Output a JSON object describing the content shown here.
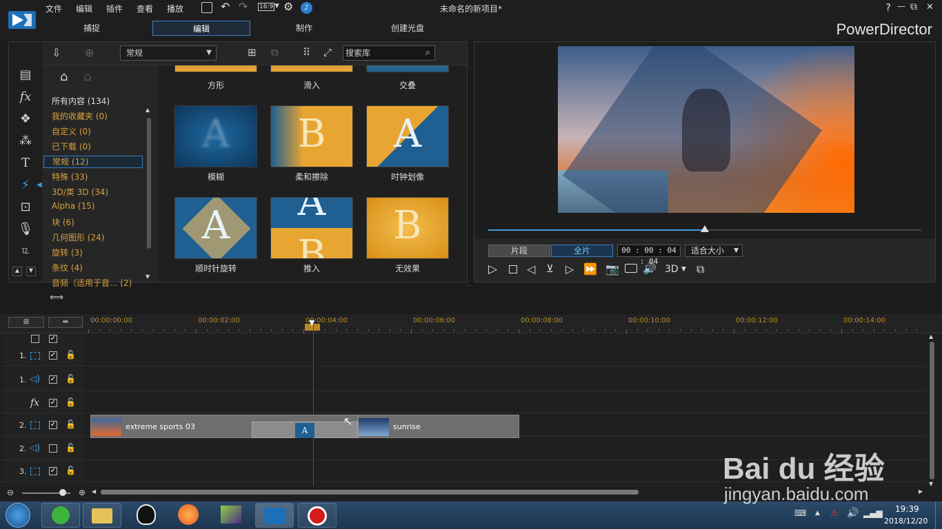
{
  "menu": [
    "文件",
    "编辑",
    "插件",
    "查看",
    "播放"
  ],
  "aspect": "16:9",
  "project_title": "未命名的新项目*",
  "window": {
    "help": "?",
    "min": "—",
    "max": "⧉",
    "close": "✕"
  },
  "tabs": [
    "捕捉",
    "编辑",
    "制作",
    "创建光盘"
  ],
  "brand": "PowerDirector",
  "library": {
    "dropdown": "常规",
    "search_placeholder": "搜索库",
    "categories": [
      "所有内容 (134)",
      "我的收藏夹  (0)",
      "自定义  (0)",
      "已下载  (0)",
      "常规  (12)",
      "特殊  (33)",
      "3D/类 3D  (34)",
      "Alpha  (15)",
      "块  (6)",
      "几何图形  (24)",
      "旋转  (3)",
      "条纹  (4)",
      "音频（适用于音...  (2)"
    ],
    "top_labels": [
      "方形",
      "滑入",
      "交叠"
    ],
    "items": [
      {
        "label": "模糊"
      },
      {
        "label": "柔和擦除"
      },
      {
        "label": "时钟划像"
      },
      {
        "label": "顺时针旋转"
      },
      {
        "label": "推入"
      },
      {
        "label": "无效果"
      }
    ]
  },
  "preview": {
    "clip_btn": "片段",
    "movie_btn": "全片",
    "timecode": "00 : 00 : 04 : 04",
    "fit": "适合大小",
    "mode3d": "3D",
    "progress": 0.5
  },
  "timeline": {
    "ruler": [
      "00:00:00:00",
      "00:00:02:00",
      "00:00:04:00",
      "00:00:06:00",
      "00:00:08:00",
      "00:00:10:00",
      "00:00:12:00",
      "00:00:14:00"
    ],
    "tracks": [
      "1.",
      "1.",
      "fx",
      "2.",
      "2.",
      "3."
    ],
    "clips": [
      {
        "name": "extreme sports 03"
      },
      {
        "name": "sunrise"
      }
    ]
  },
  "taskbar": {
    "time": "19:39",
    "date": "2018/12/20"
  },
  "watermark": {
    "logo": "Bai du 经验",
    "url": "jingyan.baidu.com"
  },
  "colors": {
    "accent": "#3d7fc1",
    "category": "#d9a23a",
    "playhead": "#d02020"
  }
}
